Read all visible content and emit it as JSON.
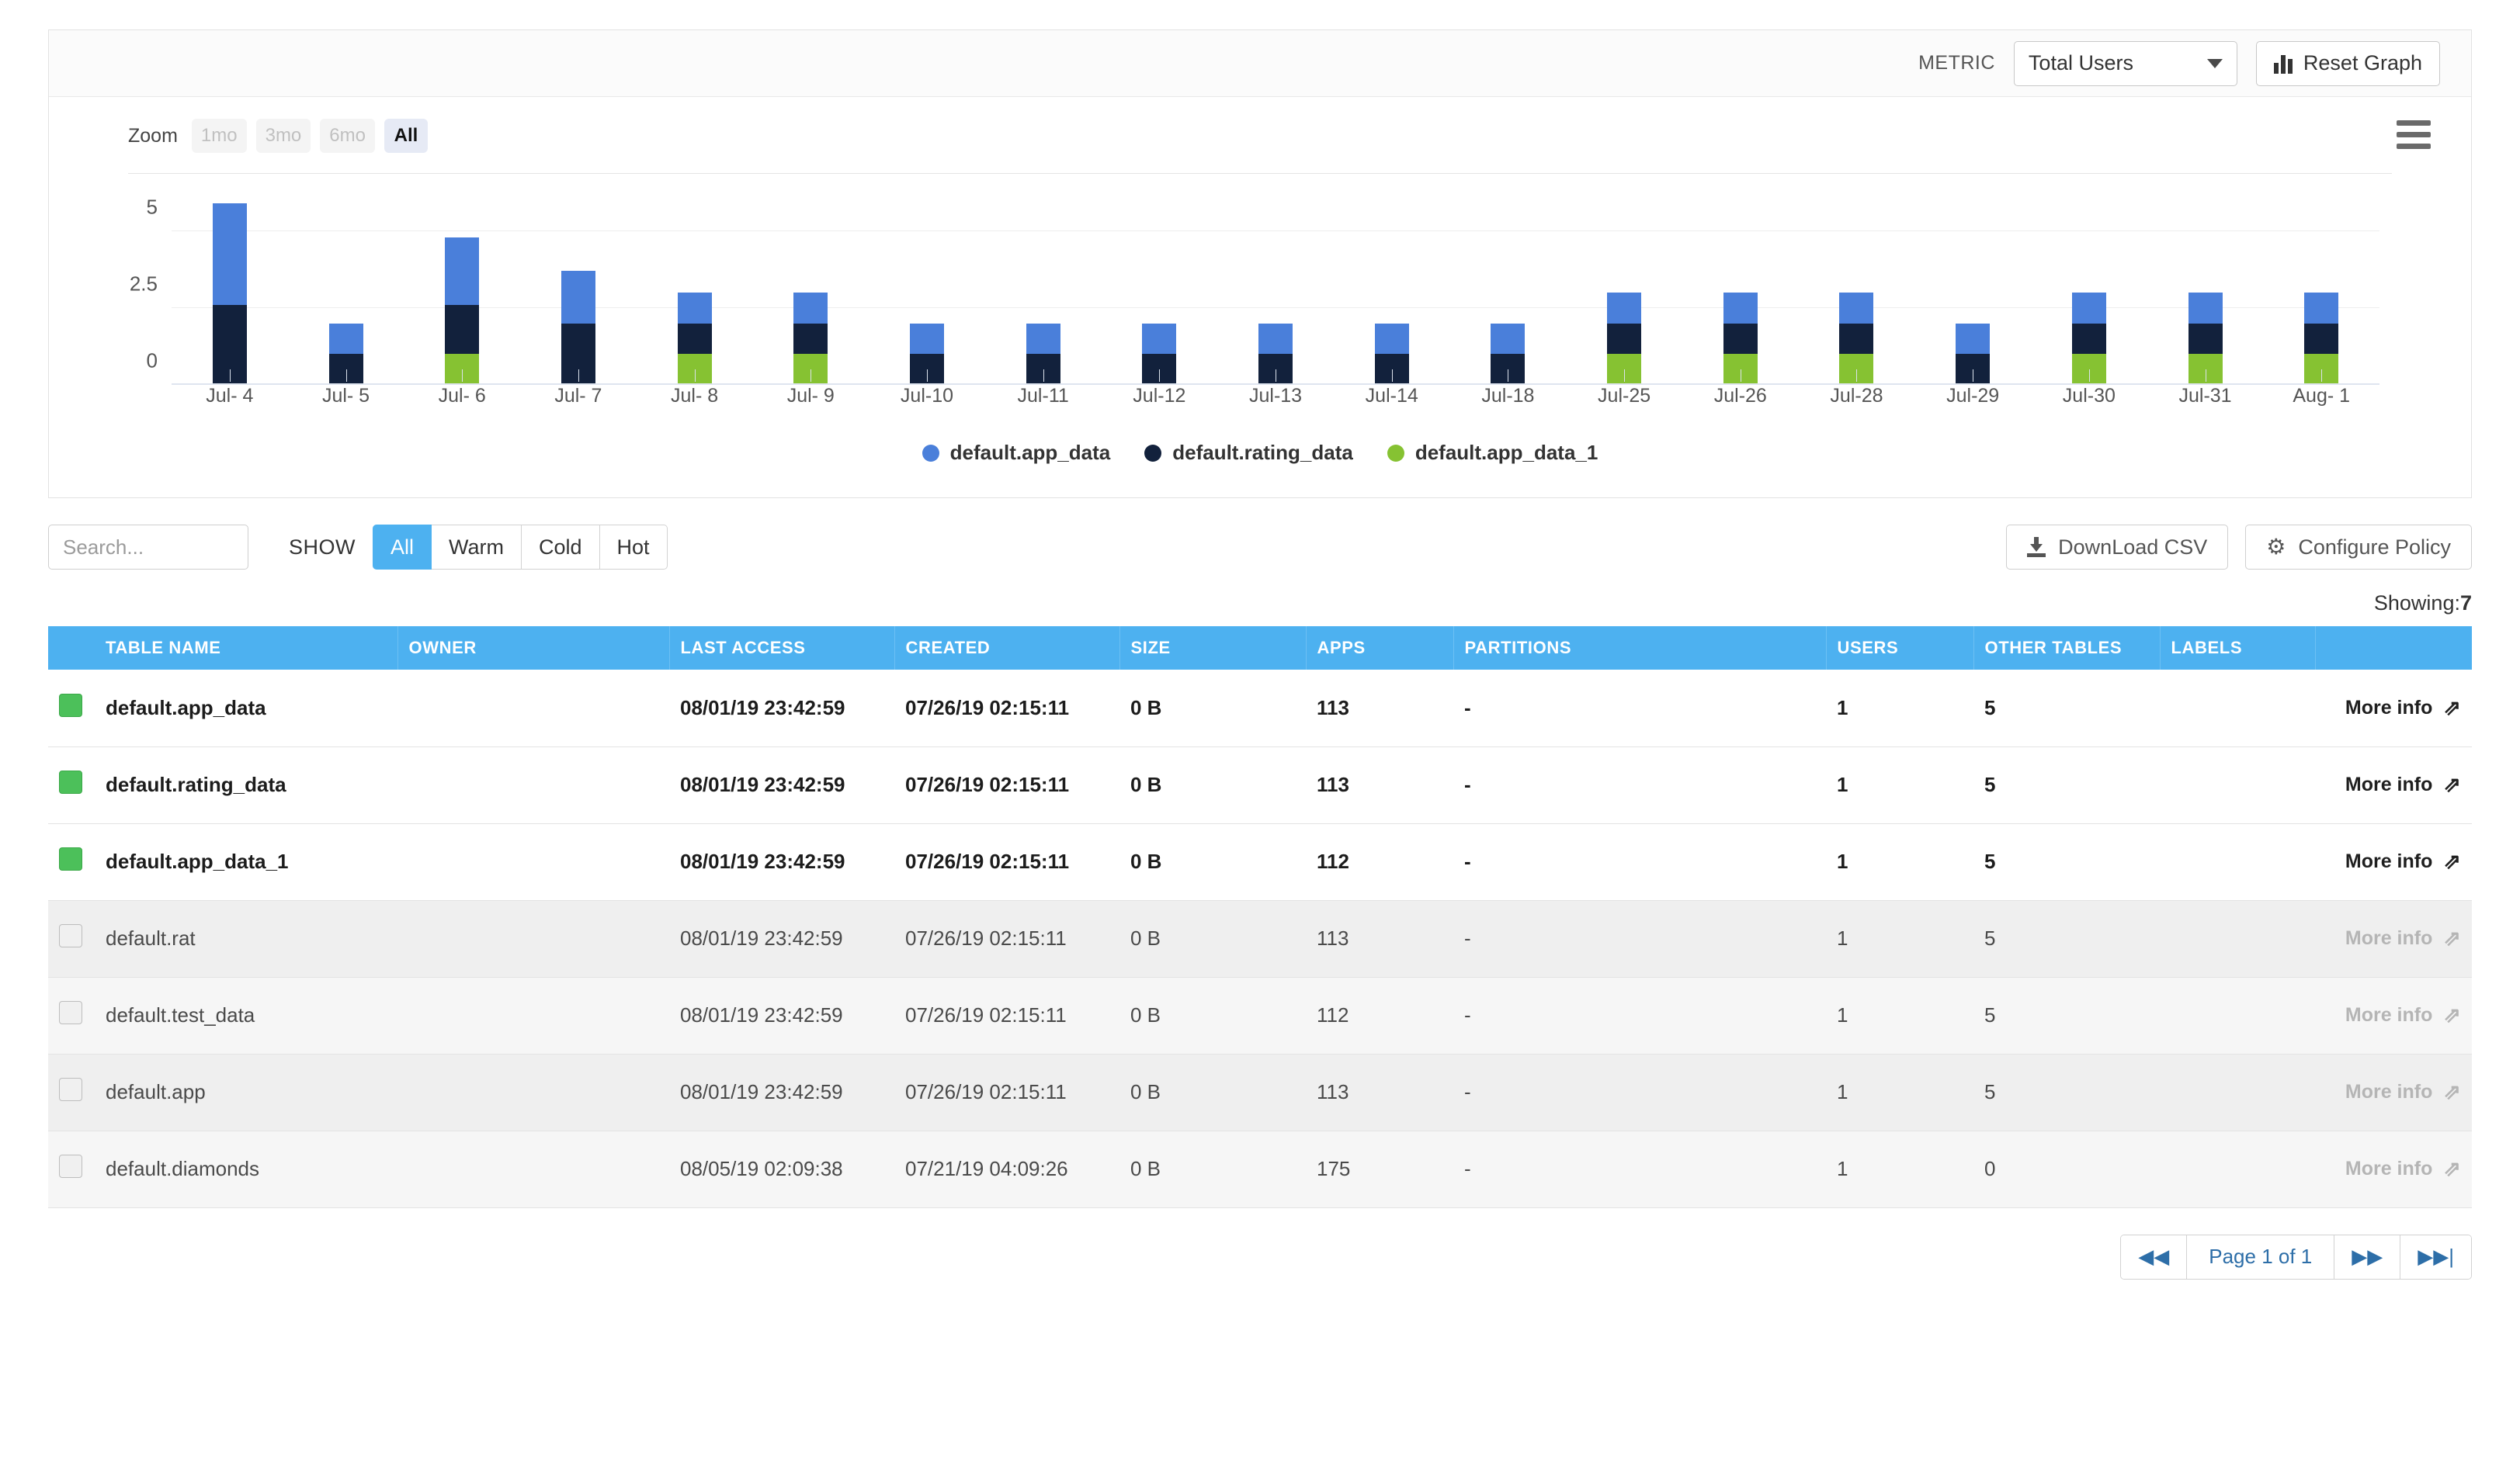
{
  "graph_toolbar": {
    "metric_label": "METRIC",
    "metric_value": "Total Users",
    "reset_label": "Reset Graph",
    "menu_icon": "hamburger-menu-icon"
  },
  "zoom_controls": {
    "label": "Zoom",
    "options": [
      "1mo",
      "3mo",
      "6mo",
      "All"
    ],
    "active": "All"
  },
  "chart_data": {
    "type": "bar",
    "stacked": true,
    "title": "",
    "xlabel": "",
    "ylabel": "",
    "ylim": [
      0,
      6.4
    ],
    "yticks": [
      0,
      2.5,
      5
    ],
    "grid": true,
    "legend_position": "bottom",
    "colors": {
      "default.app_data": "#4a7fda",
      "default.rating_data": "#12213c",
      "default.app_data_1": "#86c232"
    },
    "categories": [
      "Jul- 4",
      "Jul- 5",
      "Jul- 6",
      "Jul- 7",
      "Jul- 8",
      "Jul- 9",
      "Jul-10",
      "Jul-11",
      "Jul-12",
      "Jul-13",
      "Jul-14",
      "Jul-18",
      "Jul-25",
      "Jul-26",
      "Jul-28",
      "Jul-29",
      "Jul-30",
      "Jul-31",
      "Aug- 1"
    ],
    "series": [
      {
        "name": "default.app_data_1",
        "color": "#86c232",
        "values": [
          0,
          0,
          1,
          0,
          1,
          1,
          0,
          0,
          0,
          0,
          0,
          0,
          1,
          1,
          1,
          0,
          1,
          1,
          1
        ]
      },
      {
        "name": "default.rating_data",
        "color": "#12213c",
        "values": [
          2.6,
          1.0,
          1.6,
          2.0,
          1.0,
          1.0,
          1.0,
          1.0,
          1.0,
          1.0,
          1.0,
          1.0,
          1.0,
          1.0,
          1.0,
          1.0,
          1.0,
          1.0,
          1.0
        ]
      },
      {
        "name": "default.app_data",
        "color": "#4a7fda",
        "values": [
          3.3,
          1.0,
          2.2,
          1.7,
          1.0,
          1.0,
          1.0,
          1.0,
          1.0,
          1.0,
          1.0,
          1.0,
          1.0,
          1.0,
          1.0,
          1.0,
          1.0,
          1.0,
          1.0
        ]
      }
    ],
    "totals": [
      5.9,
      2.0,
      4.8,
      3.7,
      3.0,
      3.0,
      2.0,
      2.0,
      2.0,
      2.0,
      2.0,
      2.0,
      3.0,
      3.0,
      3.0,
      2.0,
      3.0,
      3.0,
      3.0
    ],
    "legend": [
      "default.app_data",
      "default.rating_data",
      "default.app_data_1"
    ]
  },
  "filter_bar": {
    "search_placeholder": "Search...",
    "search_value": "",
    "show_label": "SHOW",
    "show_options": [
      "All",
      "Warm",
      "Cold",
      "Hot"
    ],
    "show_active": "All",
    "download_csv": "DownLoad CSV",
    "configure_policy": "Configure Policy"
  },
  "showing": {
    "label": "Showing:",
    "count": "7"
  },
  "table": {
    "columns": [
      {
        "label": "TABLE NAME",
        "sortable": true
      },
      {
        "label": "OWNER",
        "sortable": true
      },
      {
        "label": "LAST ACCESS",
        "sortable": true
      },
      {
        "label": "CREATED",
        "sortable": true
      },
      {
        "label": "SIZE",
        "sortable": true
      },
      {
        "label": "APPS",
        "sortable": true
      },
      {
        "label": "PARTITIONS",
        "sortable": true
      },
      {
        "label": "USERS",
        "sortable": true
      },
      {
        "label": "OTHER TABLES",
        "sortable": true
      },
      {
        "label": "LABELS",
        "sortable": false
      }
    ],
    "more_info_label": "More info",
    "rows": [
      {
        "checked": true,
        "name": "default.app_data",
        "owner": "",
        "last_access": "08/01/19 23:42:59",
        "created": "07/26/19 02:15:11",
        "size": "0 B",
        "apps": "113",
        "partitions": "-",
        "users": "1",
        "other_tables": "5",
        "labels": ""
      },
      {
        "checked": true,
        "name": "default.rating_data",
        "owner": "",
        "last_access": "08/01/19 23:42:59",
        "created": "07/26/19 02:15:11",
        "size": "0 B",
        "apps": "113",
        "partitions": "-",
        "users": "1",
        "other_tables": "5",
        "labels": ""
      },
      {
        "checked": true,
        "name": "default.app_data_1",
        "owner": "",
        "last_access": "08/01/19 23:42:59",
        "created": "07/26/19 02:15:11",
        "size": "0 B",
        "apps": "112",
        "partitions": "-",
        "users": "1",
        "other_tables": "5",
        "labels": ""
      },
      {
        "checked": false,
        "name": "default.rat",
        "owner": "",
        "last_access": "08/01/19 23:42:59",
        "created": "07/26/19 02:15:11",
        "size": "0 B",
        "apps": "113",
        "partitions": "-",
        "users": "1",
        "other_tables": "5",
        "labels": ""
      },
      {
        "checked": false,
        "name": "default.test_data",
        "owner": "",
        "last_access": "08/01/19 23:42:59",
        "created": "07/26/19 02:15:11",
        "size": "0 B",
        "apps": "112",
        "partitions": "-",
        "users": "1",
        "other_tables": "5",
        "labels": ""
      },
      {
        "checked": false,
        "name": "default.app",
        "owner": "",
        "last_access": "08/01/19 23:42:59",
        "created": "07/26/19 02:15:11",
        "size": "0 B",
        "apps": "113",
        "partitions": "-",
        "users": "1",
        "other_tables": "5",
        "labels": ""
      },
      {
        "checked": false,
        "name": "default.diamonds",
        "owner": "",
        "last_access": "08/05/19 02:09:38",
        "created": "07/21/19 04:09:26",
        "size": "0 B",
        "apps": "175",
        "partitions": "-",
        "users": "1",
        "other_tables": "0",
        "labels": ""
      }
    ]
  },
  "pagination": {
    "first_icon": "◀◀",
    "page_text": "Page 1 of 1",
    "next_icon": "▶▶",
    "last_icon": "▶▶|"
  }
}
